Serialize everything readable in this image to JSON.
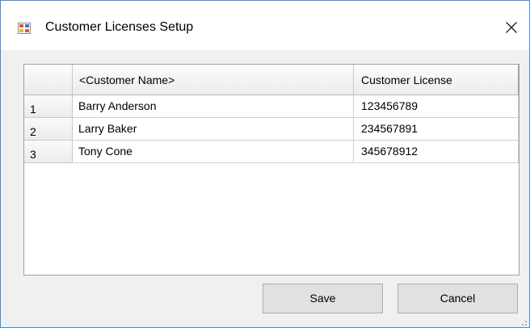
{
  "window": {
    "title": "Customer Licenses Setup",
    "app_icon": "form-app-icon",
    "close_icon": "close-icon"
  },
  "grid": {
    "columns": [
      "<Customer Name>",
      "Customer License"
    ],
    "rows": [
      {
        "num": "1",
        "name": "Barry Anderson",
        "license": "123456789"
      },
      {
        "num": "2",
        "name": "Larry Baker",
        "license": "234567891"
      },
      {
        "num": "3",
        "name": "Tony Cone",
        "license": "345678912"
      }
    ]
  },
  "buttons": {
    "save": "Save",
    "cancel": "Cancel"
  },
  "colors": {
    "window_border": "#3c8ee0",
    "dialog_background": "#f0f0f0",
    "button_face": "#e1e1e1"
  }
}
